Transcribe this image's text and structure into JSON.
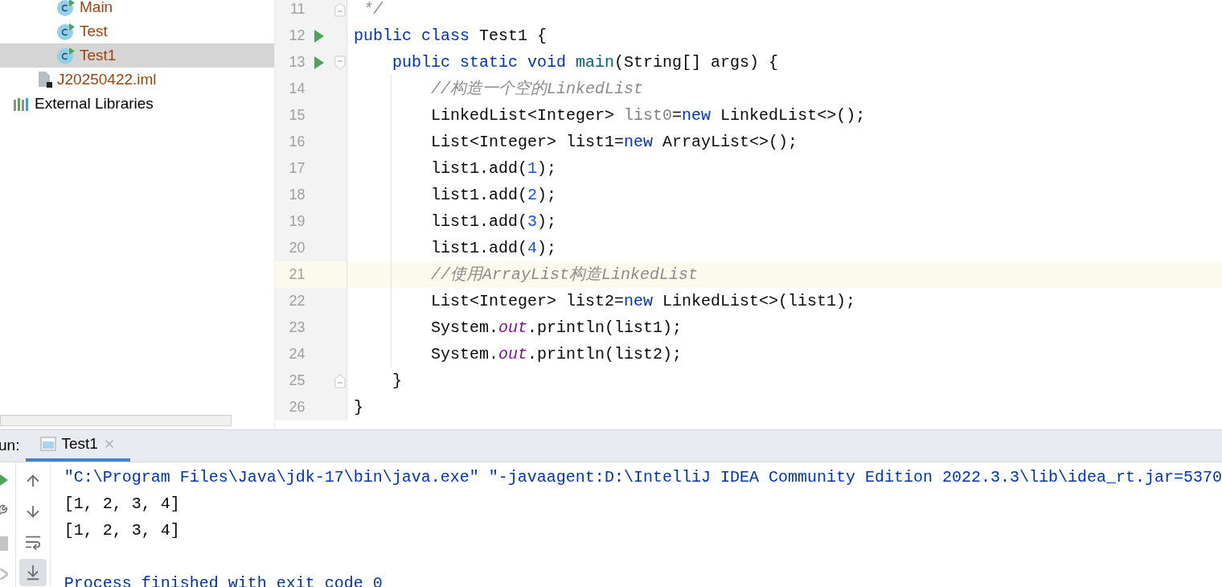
{
  "project_tree": [
    {
      "label": "Main",
      "kind": "class",
      "selected": false,
      "color": "#a0430a"
    },
    {
      "label": "Test",
      "kind": "class",
      "selected": false,
      "color": "#a0430a"
    },
    {
      "label": "Test1",
      "kind": "class",
      "selected": true,
      "color": "#a0430a"
    },
    {
      "label": "J20250422.iml",
      "kind": "file",
      "selected": false,
      "color": "#a0430a"
    },
    {
      "label": "External Libraries",
      "kind": "library",
      "selected": false,
      "color": "#000000"
    }
  ],
  "editor": {
    "lines": [
      {
        "number": "11",
        "run": false,
        "fold_open": false,
        "fold_close": true,
        "current": false,
        "guide": false,
        "tokens": [
          {
            "kind": "comment",
            "text": " */"
          }
        ]
      },
      {
        "number": "12",
        "run": true,
        "fold_open": false,
        "fold_close": false,
        "current": false,
        "guide": false,
        "tokens": [
          {
            "kind": "keyword",
            "text": "public class "
          },
          {
            "kind": "plain",
            "text": "Test1 {"
          }
        ]
      },
      {
        "number": "13",
        "run": true,
        "fold_open": true,
        "fold_close": false,
        "current": false,
        "guide": false,
        "tokens": [
          {
            "kind": "keyword",
            "text": "    public static void "
          },
          {
            "kind": "method",
            "text": "main"
          },
          {
            "kind": "plain",
            "text": "(String[] args) {"
          }
        ]
      },
      {
        "number": "14",
        "run": false,
        "fold_open": false,
        "fold_close": false,
        "current": false,
        "guide": true,
        "tokens": [
          {
            "kind": "comment",
            "text": "        //构造一个空的LinkedList"
          }
        ]
      },
      {
        "number": "15",
        "run": false,
        "fold_open": false,
        "fold_close": false,
        "current": false,
        "guide": true,
        "tokens": [
          {
            "kind": "plain",
            "text": "        LinkedList<Integer> "
          },
          {
            "kind": "unused",
            "text": "list0"
          },
          {
            "kind": "plain",
            "text": "="
          },
          {
            "kind": "keyword",
            "text": "new "
          },
          {
            "kind": "plain",
            "text": "LinkedList<>();"
          }
        ]
      },
      {
        "number": "16",
        "run": false,
        "fold_open": false,
        "fold_close": false,
        "current": false,
        "guide": true,
        "tokens": [
          {
            "kind": "plain",
            "text": "        List<Integer> list1="
          },
          {
            "kind": "keyword",
            "text": "new "
          },
          {
            "kind": "plain",
            "text": "ArrayList<>();"
          }
        ]
      },
      {
        "number": "17",
        "run": false,
        "fold_open": false,
        "fold_close": false,
        "current": false,
        "guide": true,
        "tokens": [
          {
            "kind": "plain",
            "text": "        list1.add("
          },
          {
            "kind": "number",
            "text": "1"
          },
          {
            "kind": "plain",
            "text": ");"
          }
        ]
      },
      {
        "number": "18",
        "run": false,
        "fold_open": false,
        "fold_close": false,
        "current": false,
        "guide": true,
        "tokens": [
          {
            "kind": "plain",
            "text": "        list1.add("
          },
          {
            "kind": "number",
            "text": "2"
          },
          {
            "kind": "plain",
            "text": ");"
          }
        ]
      },
      {
        "number": "19",
        "run": false,
        "fold_open": false,
        "fold_close": false,
        "current": false,
        "guide": true,
        "tokens": [
          {
            "kind": "plain",
            "text": "        list1.add("
          },
          {
            "kind": "number",
            "text": "3"
          },
          {
            "kind": "plain",
            "text": ");"
          }
        ]
      },
      {
        "number": "20",
        "run": false,
        "fold_open": false,
        "fold_close": false,
        "current": false,
        "guide": true,
        "tokens": [
          {
            "kind": "plain",
            "text": "        list1.add("
          },
          {
            "kind": "number",
            "text": "4"
          },
          {
            "kind": "plain",
            "text": ");"
          }
        ]
      },
      {
        "number": "21",
        "run": false,
        "fold_open": false,
        "fold_close": false,
        "current": true,
        "guide": true,
        "tokens": [
          {
            "kind": "comment",
            "text": "        //使用ArrayList构造LinkedList"
          }
        ]
      },
      {
        "number": "22",
        "run": false,
        "fold_open": false,
        "fold_close": false,
        "current": false,
        "guide": true,
        "tokens": [
          {
            "kind": "plain",
            "text": "        List<Integer> list2="
          },
          {
            "kind": "keyword",
            "text": "new "
          },
          {
            "kind": "plain",
            "text": "LinkedList<>(list1);"
          }
        ]
      },
      {
        "number": "23",
        "run": false,
        "fold_open": false,
        "fold_close": false,
        "current": false,
        "guide": true,
        "tokens": [
          {
            "kind": "plain",
            "text": "        System."
          },
          {
            "kind": "field",
            "text": "out"
          },
          {
            "kind": "plain",
            "text": ".println(list1);"
          }
        ]
      },
      {
        "number": "24",
        "run": false,
        "fold_open": false,
        "fold_close": false,
        "current": false,
        "guide": true,
        "tokens": [
          {
            "kind": "plain",
            "text": "        System."
          },
          {
            "kind": "field",
            "text": "out"
          },
          {
            "kind": "plain",
            "text": ".println(list2);"
          }
        ]
      },
      {
        "number": "25",
        "run": false,
        "fold_open": false,
        "fold_close": true,
        "current": false,
        "guide": false,
        "tokens": [
          {
            "kind": "plain",
            "text": "    }"
          }
        ]
      },
      {
        "number": "26",
        "run": false,
        "fold_open": false,
        "fold_close": false,
        "current": false,
        "guide": false,
        "tokens": [
          {
            "kind": "plain",
            "text": "}"
          }
        ]
      }
    ]
  },
  "run_panel": {
    "label": "un:",
    "tabs": [
      {
        "label": "Test1",
        "selected": true
      }
    ],
    "side_tools": [
      {
        "kind": "run"
      },
      {
        "kind": "wrench"
      },
      {
        "kind": "stop"
      },
      {
        "kind": "partial"
      }
    ],
    "tools": [
      {
        "kind": "up",
        "selected": false
      },
      {
        "kind": "down",
        "selected": false
      },
      {
        "kind": "wrap",
        "selected": false
      },
      {
        "kind": "scroll-end",
        "selected": true
      }
    ],
    "output": [
      {
        "kind": "command",
        "text": "\"C:\\Program Files\\Java\\jdk-17\\bin\\java.exe\" \"-javaagent:D:\\IntelliJ IDEA Community Edition 2022.3.3\\lib\\idea_rt.jar=5370"
      },
      {
        "kind": "output",
        "text": "[1, 2, 3, 4]"
      },
      {
        "kind": "output",
        "text": "[1, 2, 3, 4]"
      },
      {
        "kind": "blank"
      },
      {
        "kind": "command",
        "text": "Process finished with exit code 0"
      }
    ]
  }
}
